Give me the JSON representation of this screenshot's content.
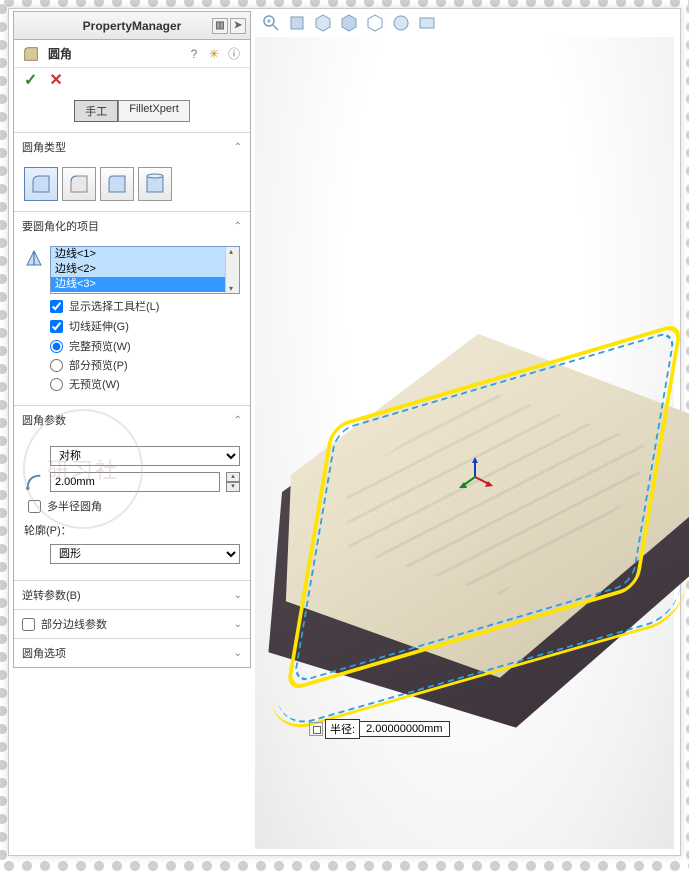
{
  "pm_title": "PropertyManager",
  "feature": {
    "name": "圆角"
  },
  "tabs": {
    "manual": "手工",
    "xpert": "FilletXpert"
  },
  "sections": {
    "type": {
      "title": "圆角类型"
    },
    "items": {
      "title": "要圆角化的项目",
      "edges": [
        "边线<1>",
        "边线<2>",
        "边线<3>"
      ],
      "show_toolbar": "显示选择工具栏(L)",
      "tangent": "切线延伸(G)",
      "full_preview": "完整预览(W)",
      "partial_preview": "部分预览(P)",
      "no_preview": "无预览(W)"
    },
    "params": {
      "title": "圆角参数",
      "symmetry": "对称",
      "radius": "2.00mm",
      "multi": "多半径圆角",
      "profile_label": "轮廓(P)：",
      "profile_value": "圆形"
    },
    "reverse": {
      "title": "逆转参数(B)"
    },
    "partial_edge": {
      "title": "部分边线参数"
    },
    "options": {
      "title": "圆角选项"
    }
  },
  "callout": {
    "label": "半径:",
    "value": "2.00000000mm"
  },
  "watermark": "研习社"
}
